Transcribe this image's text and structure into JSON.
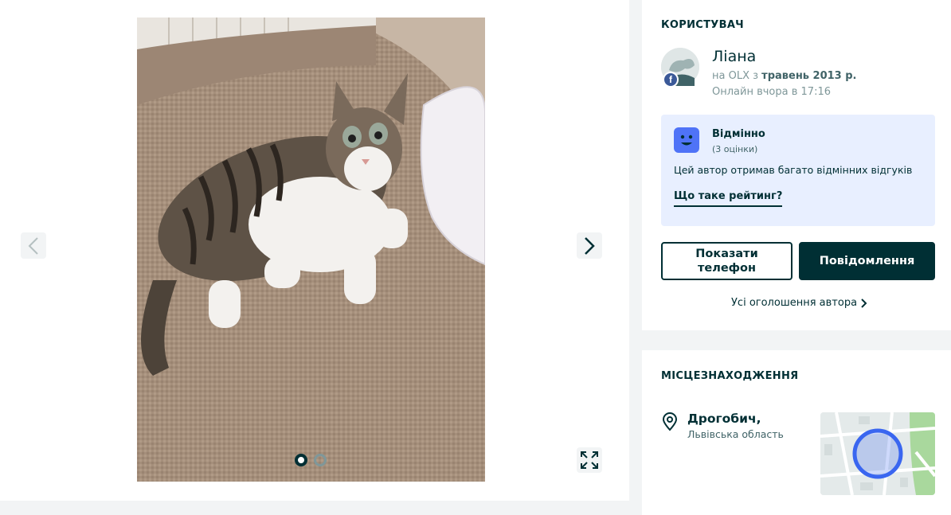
{
  "gallery": {
    "prev_icon": "chevron-left-icon",
    "next_icon": "chevron-right-icon",
    "fullscreen_icon": "expand-icon",
    "dots": [
      {
        "active": true
      },
      {
        "active": false
      }
    ]
  },
  "user": {
    "section_title": "КОРИСТУВАЧ",
    "name": "Ліана",
    "since_prefix": "на OLX з ",
    "since_date": "травень 2013 р.",
    "online": "Онлайн вчора в 17:16",
    "badge": "f"
  },
  "rating": {
    "title": "Відмінно",
    "count": "(3 оцінки)",
    "description": "Цей автор отримав багато відмінних відгуків",
    "link": "Що таке рейтинг?"
  },
  "actions": {
    "phone_line1": "Показати",
    "phone_line2": "телефон",
    "message": "Повідомлення",
    "all_ads": "Усі оголошення автора"
  },
  "location": {
    "section_title": "МІСЦЕЗНАХОДЖЕННЯ",
    "city": "Дрогобич,",
    "region": "Львівська область"
  },
  "colors": {
    "primary": "#002f34",
    "rating_bg": "#e8efff",
    "rating_face": "#4f73f7",
    "map_circle": "#3a66f0"
  }
}
